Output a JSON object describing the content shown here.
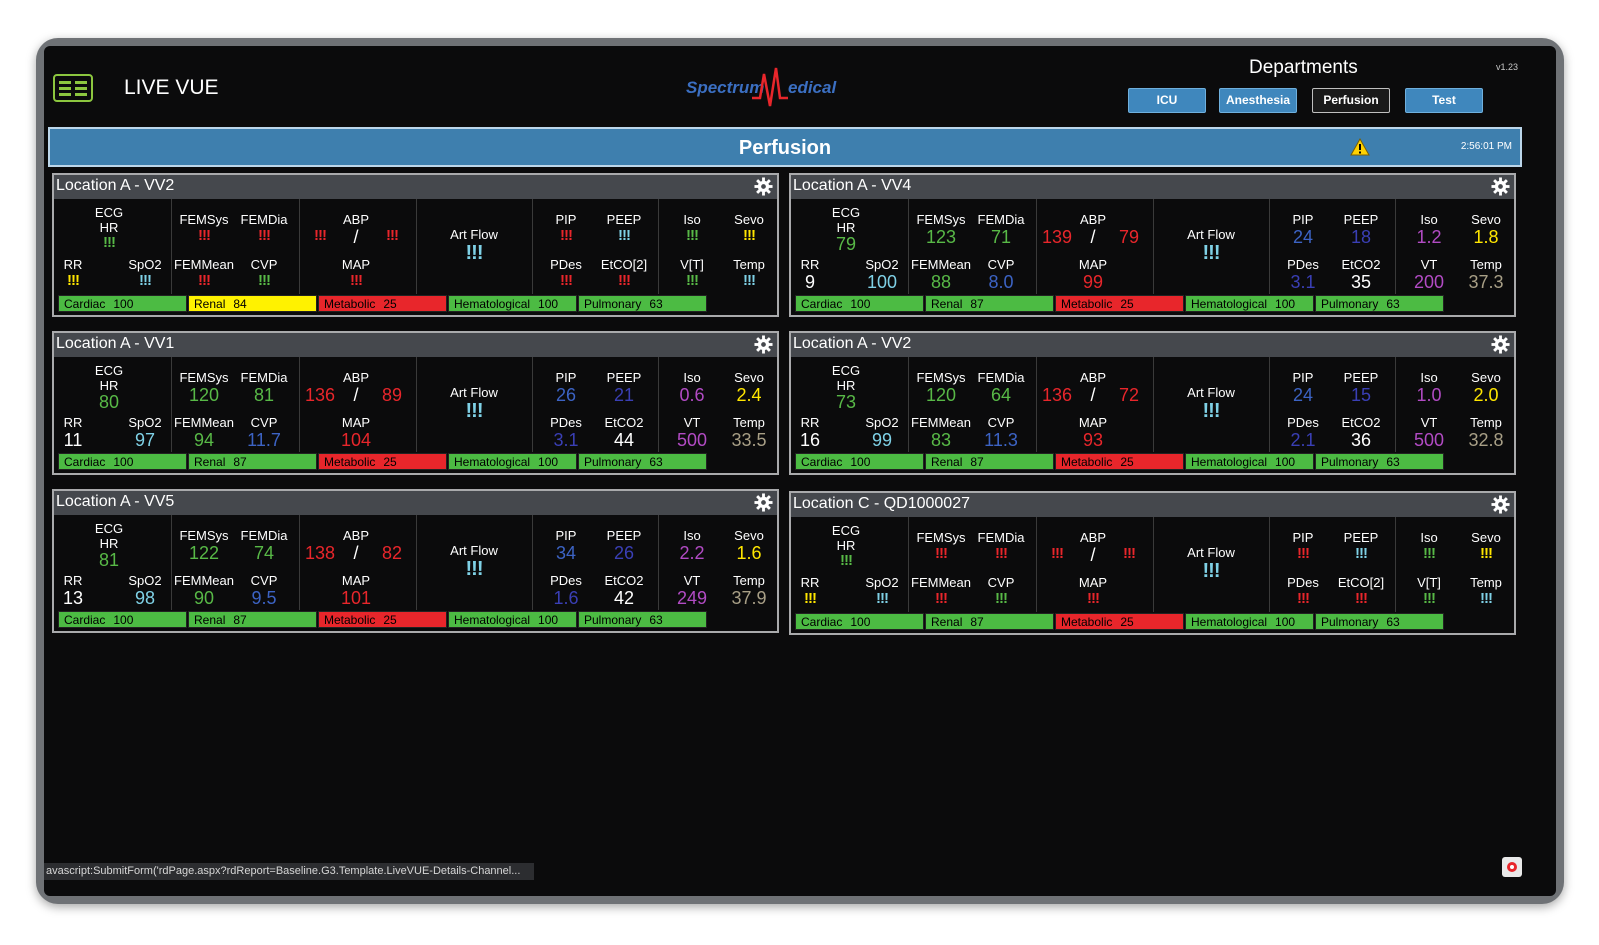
{
  "header": {
    "app_title": "LIVE VUE",
    "logo_text_left": "Spectrum",
    "logo_text_right": "edical",
    "departments_title": "Departments",
    "version": "v1.23",
    "dept_buttons": [
      "ICU",
      "Anesthesia",
      "Perfusion",
      "Test"
    ],
    "active_dept": "Perfusion"
  },
  "banner": {
    "title": "Perfusion",
    "time": "2:56:01 PM"
  },
  "labels": {
    "ecg": "ECG",
    "hr": "HR",
    "rr": "RR",
    "spo2": "SpO2",
    "femsys": "FEMSys",
    "femdia": "FEMDia",
    "femmean": "FEMMean",
    "cvp": "CVP",
    "abp": "ABP",
    "slash": "/",
    "map": "MAP",
    "artflow": "Art Flow",
    "pip": "PIP",
    "peep": "PEEP",
    "pdes": "PDes",
    "iso": "Iso",
    "sevo": "Sevo",
    "temp": "Temp"
  },
  "colors": {
    "green": "#58b947",
    "red": "#e8262b",
    "yellow": "#ffe600",
    "blue": "#3c63c4",
    "cyan": "#7fd1e6",
    "magenta": "#b24bc4",
    "tan": "#a89f86",
    "white": "#ffffff",
    "violet": "#3a3fb5"
  },
  "panels": [
    {
      "title": "Location A - VV2",
      "hr": {
        "v": "!!!",
        "c": "green"
      },
      "rr": {
        "v": "!!!",
        "c": "yellow"
      },
      "spo2": {
        "v": "!!!",
        "c": "cyan"
      },
      "femsys": {
        "v": "!!!",
        "c": "red"
      },
      "femdia": {
        "v": "!!!",
        "c": "red"
      },
      "femmean": {
        "v": "!!!",
        "c": "red"
      },
      "cvp": {
        "v": "!!!",
        "c": "green"
      },
      "abp_s": {
        "v": "!!!",
        "c": "red"
      },
      "abp_d": {
        "v": "!!!",
        "c": "red"
      },
      "map": {
        "v": "!!!",
        "c": "red"
      },
      "artflow": {
        "v": "!!!",
        "c": "cyan"
      },
      "pip": {
        "v": "!!!",
        "c": "red"
      },
      "peep": {
        "v": "!!!",
        "c": "cyan"
      },
      "pdes": {
        "v": "!!!",
        "c": "red"
      },
      "etco2": {
        "v": "!!!",
        "c": "red"
      },
      "etco2_label": "EtCO[2]",
      "vt_label": "V[T]",
      "iso": {
        "v": "!!!",
        "c": "green"
      },
      "sevo": {
        "v": "!!!",
        "c": "yellow"
      },
      "vt": {
        "v": "!!!",
        "c": "green"
      },
      "temp": {
        "v": "!!!",
        "c": "cyan"
      },
      "strip": [
        {
          "name": "Cardiac",
          "score": "100",
          "bg": "#4cbb43",
          "fg": "#000000"
        },
        {
          "name": "Renal",
          "score": "84",
          "bg": "#fff200",
          "fg": "#000000"
        },
        {
          "name": "Metabolic",
          "score": "25",
          "bg": "#e8262b",
          "fg": "#000000"
        },
        {
          "name": "Hematological",
          "score": "100",
          "bg": "#4cbb43",
          "fg": "#000000"
        },
        {
          "name": "Pulmonary",
          "score": "63",
          "bg": "#4cbb43",
          "fg": "#000000"
        }
      ]
    },
    {
      "title": "Location A - VV4",
      "hr": {
        "v": "79",
        "c": "green"
      },
      "rr": {
        "v": "9",
        "c": "white"
      },
      "spo2": {
        "v": "100",
        "c": "cyan"
      },
      "femsys": {
        "v": "123",
        "c": "green"
      },
      "femdia": {
        "v": "71",
        "c": "green"
      },
      "femmean": {
        "v": "88",
        "c": "green"
      },
      "cvp": {
        "v": "8.0",
        "c": "blue"
      },
      "abp_s": {
        "v": "139",
        "c": "red"
      },
      "abp_d": {
        "v": "79",
        "c": "red"
      },
      "map": {
        "v": "99",
        "c": "red"
      },
      "artflow": {
        "v": "!!!",
        "c": "cyan"
      },
      "pip": {
        "v": "24",
        "c": "blue"
      },
      "peep": {
        "v": "18",
        "c": "violet"
      },
      "pdes": {
        "v": "3.1",
        "c": "violet"
      },
      "etco2": {
        "v": "35",
        "c": "white"
      },
      "etco2_label": "EtCO2",
      "vt_label": "VT",
      "iso": {
        "v": "1.2",
        "c": "magenta"
      },
      "sevo": {
        "v": "1.8",
        "c": "yellow"
      },
      "vt": {
        "v": "200",
        "c": "magenta"
      },
      "temp": {
        "v": "37.3",
        "c": "tan"
      },
      "strip": [
        {
          "name": "Cardiac",
          "score": "100",
          "bg": "#4cbb43",
          "fg": "#000000"
        },
        {
          "name": "Renal",
          "score": "87",
          "bg": "#4cbb43",
          "fg": "#000000"
        },
        {
          "name": "Metabolic",
          "score": "25",
          "bg": "#e8262b",
          "fg": "#000000"
        },
        {
          "name": "Hematological",
          "score": "100",
          "bg": "#4cbb43",
          "fg": "#000000"
        },
        {
          "name": "Pulmonary",
          "score": "63",
          "bg": "#4cbb43",
          "fg": "#000000"
        }
      ]
    },
    {
      "title": "Location A - VV1",
      "hr": {
        "v": "80",
        "c": "green"
      },
      "rr": {
        "v": "11",
        "c": "white"
      },
      "spo2": {
        "v": "97",
        "c": "cyan"
      },
      "femsys": {
        "v": "120",
        "c": "green"
      },
      "femdia": {
        "v": "81",
        "c": "green"
      },
      "femmean": {
        "v": "94",
        "c": "green"
      },
      "cvp": {
        "v": "11.7",
        "c": "blue"
      },
      "abp_s": {
        "v": "136",
        "c": "red"
      },
      "abp_d": {
        "v": "89",
        "c": "red"
      },
      "map": {
        "v": "104",
        "c": "red"
      },
      "artflow": {
        "v": "!!!",
        "c": "cyan"
      },
      "pip": {
        "v": "26",
        "c": "blue"
      },
      "peep": {
        "v": "21",
        "c": "violet"
      },
      "pdes": {
        "v": "3.1",
        "c": "violet"
      },
      "etco2": {
        "v": "44",
        "c": "white"
      },
      "etco2_label": "EtCO2",
      "vt_label": "VT",
      "iso": {
        "v": "0.6",
        "c": "magenta"
      },
      "sevo": {
        "v": "2.4",
        "c": "yellow"
      },
      "vt": {
        "v": "500",
        "c": "magenta"
      },
      "temp": {
        "v": "33.5",
        "c": "tan"
      },
      "strip": [
        {
          "name": "Cardiac",
          "score": "100",
          "bg": "#4cbb43",
          "fg": "#000000"
        },
        {
          "name": "Renal",
          "score": "87",
          "bg": "#4cbb43",
          "fg": "#000000"
        },
        {
          "name": "Metabolic",
          "score": "25",
          "bg": "#e8262b",
          "fg": "#000000"
        },
        {
          "name": "Hematological",
          "score": "100",
          "bg": "#4cbb43",
          "fg": "#000000"
        },
        {
          "name": "Pulmonary",
          "score": "63",
          "bg": "#4cbb43",
          "fg": "#000000"
        }
      ]
    },
    {
      "title": "Location A - VV2",
      "hr": {
        "v": "73",
        "c": "green"
      },
      "rr": {
        "v": "16",
        "c": "white"
      },
      "spo2": {
        "v": "99",
        "c": "cyan"
      },
      "femsys": {
        "v": "120",
        "c": "green"
      },
      "femdia": {
        "v": "64",
        "c": "green"
      },
      "femmean": {
        "v": "83",
        "c": "green"
      },
      "cvp": {
        "v": "11.3",
        "c": "blue"
      },
      "abp_s": {
        "v": "136",
        "c": "red"
      },
      "abp_d": {
        "v": "72",
        "c": "red"
      },
      "map": {
        "v": "93",
        "c": "red"
      },
      "artflow": {
        "v": "!!!",
        "c": "cyan"
      },
      "pip": {
        "v": "24",
        "c": "blue"
      },
      "peep": {
        "v": "15",
        "c": "violet"
      },
      "pdes": {
        "v": "2.1",
        "c": "violet"
      },
      "etco2": {
        "v": "36",
        "c": "white"
      },
      "etco2_label": "EtCO2",
      "vt_label": "VT",
      "iso": {
        "v": "1.0",
        "c": "magenta"
      },
      "sevo": {
        "v": "2.0",
        "c": "yellow"
      },
      "vt": {
        "v": "500",
        "c": "magenta"
      },
      "temp": {
        "v": "32.8",
        "c": "tan"
      },
      "strip": [
        {
          "name": "Cardiac",
          "score": "100",
          "bg": "#4cbb43",
          "fg": "#000000"
        },
        {
          "name": "Renal",
          "score": "87",
          "bg": "#4cbb43",
          "fg": "#000000"
        },
        {
          "name": "Metabolic",
          "score": "25",
          "bg": "#e8262b",
          "fg": "#000000"
        },
        {
          "name": "Hematological",
          "score": "100",
          "bg": "#4cbb43",
          "fg": "#000000"
        },
        {
          "name": "Pulmonary",
          "score": "63",
          "bg": "#4cbb43",
          "fg": "#000000"
        }
      ]
    },
    {
      "title": "Location A - VV5",
      "hr": {
        "v": "81",
        "c": "green"
      },
      "rr": {
        "v": "13",
        "c": "white"
      },
      "spo2": {
        "v": "98",
        "c": "cyan"
      },
      "femsys": {
        "v": "122",
        "c": "green"
      },
      "femdia": {
        "v": "74",
        "c": "green"
      },
      "femmean": {
        "v": "90",
        "c": "green"
      },
      "cvp": {
        "v": "9.5",
        "c": "blue"
      },
      "abp_s": {
        "v": "138",
        "c": "red"
      },
      "abp_d": {
        "v": "82",
        "c": "red"
      },
      "map": {
        "v": "101",
        "c": "red"
      },
      "artflow": {
        "v": "!!!",
        "c": "cyan"
      },
      "pip": {
        "v": "34",
        "c": "blue"
      },
      "peep": {
        "v": "26",
        "c": "violet"
      },
      "pdes": {
        "v": "1.6",
        "c": "violet"
      },
      "etco2": {
        "v": "42",
        "c": "white"
      },
      "etco2_label": "EtCO2",
      "vt_label": "VT",
      "iso": {
        "v": "2.2",
        "c": "magenta"
      },
      "sevo": {
        "v": "1.6",
        "c": "yellow"
      },
      "vt": {
        "v": "249",
        "c": "magenta"
      },
      "temp": {
        "v": "37.9",
        "c": "tan"
      },
      "strip": [
        {
          "name": "Cardiac",
          "score": "100",
          "bg": "#4cbb43",
          "fg": "#000000"
        },
        {
          "name": "Renal",
          "score": "87",
          "bg": "#4cbb43",
          "fg": "#000000"
        },
        {
          "name": "Metabolic",
          "score": "25",
          "bg": "#e8262b",
          "fg": "#000000"
        },
        {
          "name": "Hematological",
          "score": "100",
          "bg": "#4cbb43",
          "fg": "#000000"
        },
        {
          "name": "Pulmonary",
          "score": "63",
          "bg": "#4cbb43",
          "fg": "#000000"
        }
      ]
    },
    {
      "title": "Location C - QD1000027",
      "hr": {
        "v": "!!!",
        "c": "green"
      },
      "rr": {
        "v": "!!!",
        "c": "yellow"
      },
      "spo2": {
        "v": "!!!",
        "c": "cyan"
      },
      "femsys": {
        "v": "!!!",
        "c": "red"
      },
      "femdia": {
        "v": "!!!",
        "c": "red"
      },
      "femmean": {
        "v": "!!!",
        "c": "red"
      },
      "cvp": {
        "v": "!!!",
        "c": "green"
      },
      "abp_s": {
        "v": "!!!",
        "c": "red"
      },
      "abp_d": {
        "v": "!!!",
        "c": "red"
      },
      "map": {
        "v": "!!!",
        "c": "red"
      },
      "artflow": {
        "v": "!!!",
        "c": "cyan"
      },
      "pip": {
        "v": "!!!",
        "c": "red"
      },
      "peep": {
        "v": "!!!",
        "c": "cyan"
      },
      "pdes": {
        "v": "!!!",
        "c": "red"
      },
      "etco2": {
        "v": "!!!",
        "c": "red"
      },
      "etco2_label": "EtCO[2]",
      "vt_label": "V[T]",
      "iso": {
        "v": "!!!",
        "c": "green"
      },
      "sevo": {
        "v": "!!!",
        "c": "yellow"
      },
      "vt": {
        "v": "!!!",
        "c": "green"
      },
      "temp": {
        "v": "!!!",
        "c": "cyan"
      },
      "strip": [
        {
          "name": "Cardiac",
          "score": "100",
          "bg": "#4cbb43",
          "fg": "#000000"
        },
        {
          "name": "Renal",
          "score": "87",
          "bg": "#4cbb43",
          "fg": "#000000"
        },
        {
          "name": "Metabolic",
          "score": "25",
          "bg": "#e8262b",
          "fg": "#000000"
        },
        {
          "name": "Hematological",
          "score": "100",
          "bg": "#4cbb43",
          "fg": "#000000"
        },
        {
          "name": "Pulmonary",
          "score": "63",
          "bg": "#4cbb43",
          "fg": "#000000"
        }
      ]
    }
  ],
  "status_bar": {
    "url": "avascript:SubmitForm('rdPage.aspx?rdReport=Baseline.G3.Template.LiveVUE-Details-Channel..."
  }
}
